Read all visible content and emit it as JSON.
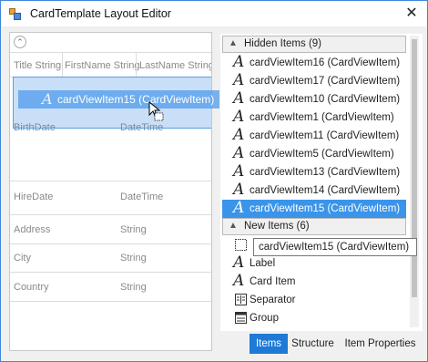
{
  "window": {
    "title": "CardTemplate Layout Editor",
    "close_glyph": "✕"
  },
  "designer": {
    "collapse_glyph": "⌃",
    "header_cells": [
      "Title String",
      "FirstName String",
      "LastName String"
    ],
    "rows": [
      {
        "label": "BirthDate",
        "type": "DateTime"
      },
      {
        "label": "HireDate",
        "type": "DateTime"
      },
      {
        "label": "Address",
        "type": "String"
      },
      {
        "label": "City",
        "type": "String"
      },
      {
        "label": "Country",
        "type": "String"
      }
    ],
    "drag_item": {
      "icon": "text-item-icon",
      "glyph": "A",
      "label": "cardViewItem15 (CardViewItem)"
    }
  },
  "items_panel": {
    "hidden_group": {
      "label": "Hidden Items (9)"
    },
    "hidden_items": [
      "cardViewItem16 (CardViewItem)",
      "cardViewItem17 (CardViewItem)",
      "cardViewItem10 (CardViewItem)",
      "cardViewItem1 (CardViewItem)",
      "cardViewItem11 (CardViewItem)",
      "cardViewItem5 (CardViewItem)",
      "cardViewItem13 (CardViewItem)",
      "cardViewItem14 (CardViewItem)",
      "cardViewItem15 (CardViewItem)"
    ],
    "selected_hidden_item": "cardViewItem15 (CardViewItem)",
    "new_group": {
      "label": "New Items (6)"
    },
    "new_items": [
      {
        "label": "",
        "icon": "empty-space-icon"
      },
      {
        "label": "Label",
        "icon": "label-icon"
      },
      {
        "label": "Card Item",
        "icon": "card-item-icon"
      },
      {
        "label": "Separator",
        "icon": "separator-icon"
      },
      {
        "label": "Group",
        "icon": "group-icon"
      }
    ],
    "item_glyph": "A",
    "chevron_glyph": "▲"
  },
  "tooltip": {
    "text": "cardViewItem15 (CardViewItem)"
  },
  "tabs": [
    {
      "label": "Items",
      "active": true
    },
    {
      "label": "Structure",
      "active": false
    },
    {
      "label": "Item Properties",
      "active": false
    }
  ],
  "colors": {
    "accent": "#1e7ad6",
    "selection": "#3a94ea",
    "drag_overlay": "#5a9de0"
  }
}
